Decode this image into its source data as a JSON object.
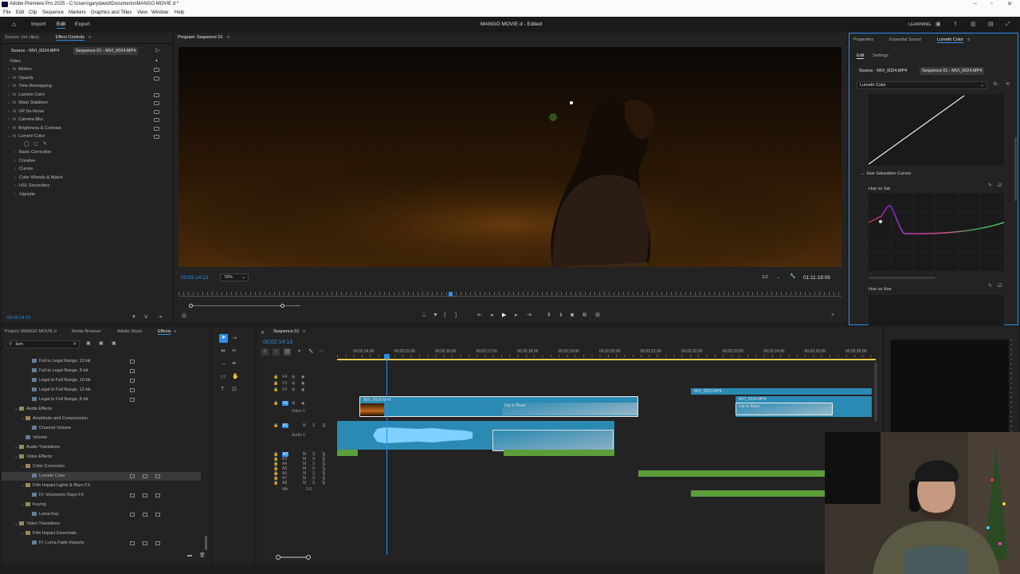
{
  "titlebar": {
    "title": "Adobe Premiere Pro 2025 - C:\\Users\\garydavid\\Documents\\MANGO MOVIE d *"
  },
  "menu": [
    "File",
    "Edit",
    "Clip",
    "Sequence",
    "Markers",
    "Graphics and Titles",
    "View",
    "Window",
    "Help"
  ],
  "workspace": {
    "import": "Import",
    "edit": "Edit",
    "export": "Export",
    "project_title": "MANGO MOVIE d - Edited",
    "learning": "LEARNING"
  },
  "effect_controls": {
    "tab_source": "Source: (no clips)",
    "tab_active": "Effect Controls",
    "source_label": "Source - MVI_0024.MP4",
    "sequence_label": "Sequence 01 - MVI_0024.MP4",
    "section": "Video",
    "effects": [
      "Motion",
      "Opacity",
      "Time Remapping",
      "Lumetri Color",
      "Warp Stabilizer",
      "VR De-Noise",
      "Camera Blur",
      "Brightness & Contrast",
      "Lumetri Color"
    ],
    "lumetri_sub": [
      "Basic Correction",
      "Creative",
      "Curves",
      "Color Wheels & Match",
      "HSL Secondary",
      "Vignette"
    ],
    "timecode": "00:02:14:13"
  },
  "program": {
    "tab": "Program: Sequence 01",
    "timecode": "00:02:14:13",
    "zoom": "78%",
    "resolution": "1/2",
    "duration": "01:11:18:09"
  },
  "lumetri": {
    "tabs": [
      "Properties",
      "Essential Sound",
      "Lumetri Color"
    ],
    "subtabs": [
      "Edit",
      "Settings"
    ],
    "source_label": "Source - MVI_0024.MP4",
    "sequence_label": "Sequence 01 - MVI_0024.MP4",
    "effect_select": "Lumetri Color",
    "section": "Hue Saturation Curves",
    "curve1": "Hue vs Sat",
    "curve2": "Hue vs Hue"
  },
  "project": {
    "tabs": [
      "Project: MANGO MOVIE d",
      "Media Browser",
      "Adobe Stock",
      "Effects"
    ],
    "search": "lum",
    "items": [
      {
        "label": "Full to Legal Range, 12-bit",
        "indent": 3
      },
      {
        "label": "Full to Legal Range, 8-bit",
        "indent": 3
      },
      {
        "label": "Legal to Full Range, 10-bit",
        "indent": 3
      },
      {
        "label": "Legal to Full Range, 12-bit",
        "indent": 3
      },
      {
        "label": "Legal to Full Range, 8-bit",
        "indent": 3
      },
      {
        "label": "Audio Effects",
        "indent": 1,
        "folder": true
      },
      {
        "label": "Amplitude and Compression",
        "indent": 2,
        "folder": true
      },
      {
        "label": "Channel Volume",
        "indent": 3
      },
      {
        "label": "Volume",
        "indent": 2
      },
      {
        "label": "Audio Transitions",
        "indent": 1,
        "folder": true
      },
      {
        "label": "Video Effects",
        "indent": 1,
        "folder": true
      },
      {
        "label": "Color Correction",
        "indent": 2,
        "folder": true
      },
      {
        "label": "Lumetri Color",
        "indent": 3,
        "selected": true
      },
      {
        "label": "Film Impact Lights & Blurs FX",
        "indent": 2,
        "folder": true
      },
      {
        "label": "FI: Volumetric Rays FX",
        "indent": 3
      },
      {
        "label": "Keying",
        "indent": 2,
        "folder": true
      },
      {
        "label": "Luma Key",
        "indent": 3
      },
      {
        "label": "Video Transitions",
        "indent": 1,
        "folder": true
      },
      {
        "label": "Film Impact Essentials",
        "indent": 2,
        "folder": true
      },
      {
        "label": "FI: Luma Fade Impacts",
        "indent": 3
      }
    ]
  },
  "timeline": {
    "tab": "Sequence 01",
    "timecode": "00:02:14:13",
    "ruler": [
      "00;02;14;00",
      "00;02;15;00",
      "00;02;16;00",
      "00;02;17;00",
      "00;02;18;00",
      "00;02;19;00",
      "00;02;20;00",
      "00;02;21;00",
      "00;02;22;00",
      "00;02;23;00",
      "00;02;24;00",
      "00;02;25;00",
      "00;02;26;00"
    ],
    "video_tracks": [
      "V4",
      "V3",
      "V2",
      "V1"
    ],
    "video1_label": "Video 1",
    "audio_tracks": [
      "A1",
      "A2",
      "A3",
      "A4",
      "A5",
      "A6",
      "A7",
      "A8"
    ],
    "audio1_label": "Audio 1",
    "mix": "Mix",
    "mix_val": "0.0",
    "clip1": "MVI_0024.MP4",
    "clip2": "MVI_0023.MP4",
    "clip3": "MVI_0024.MP4",
    "transition1": "Dip to Black",
    "transition2": "Dip to Black"
  },
  "colors": {
    "accent": "#2d8ceb",
    "clip": "#2a8ab3",
    "audio": "#5c9e3a"
  }
}
